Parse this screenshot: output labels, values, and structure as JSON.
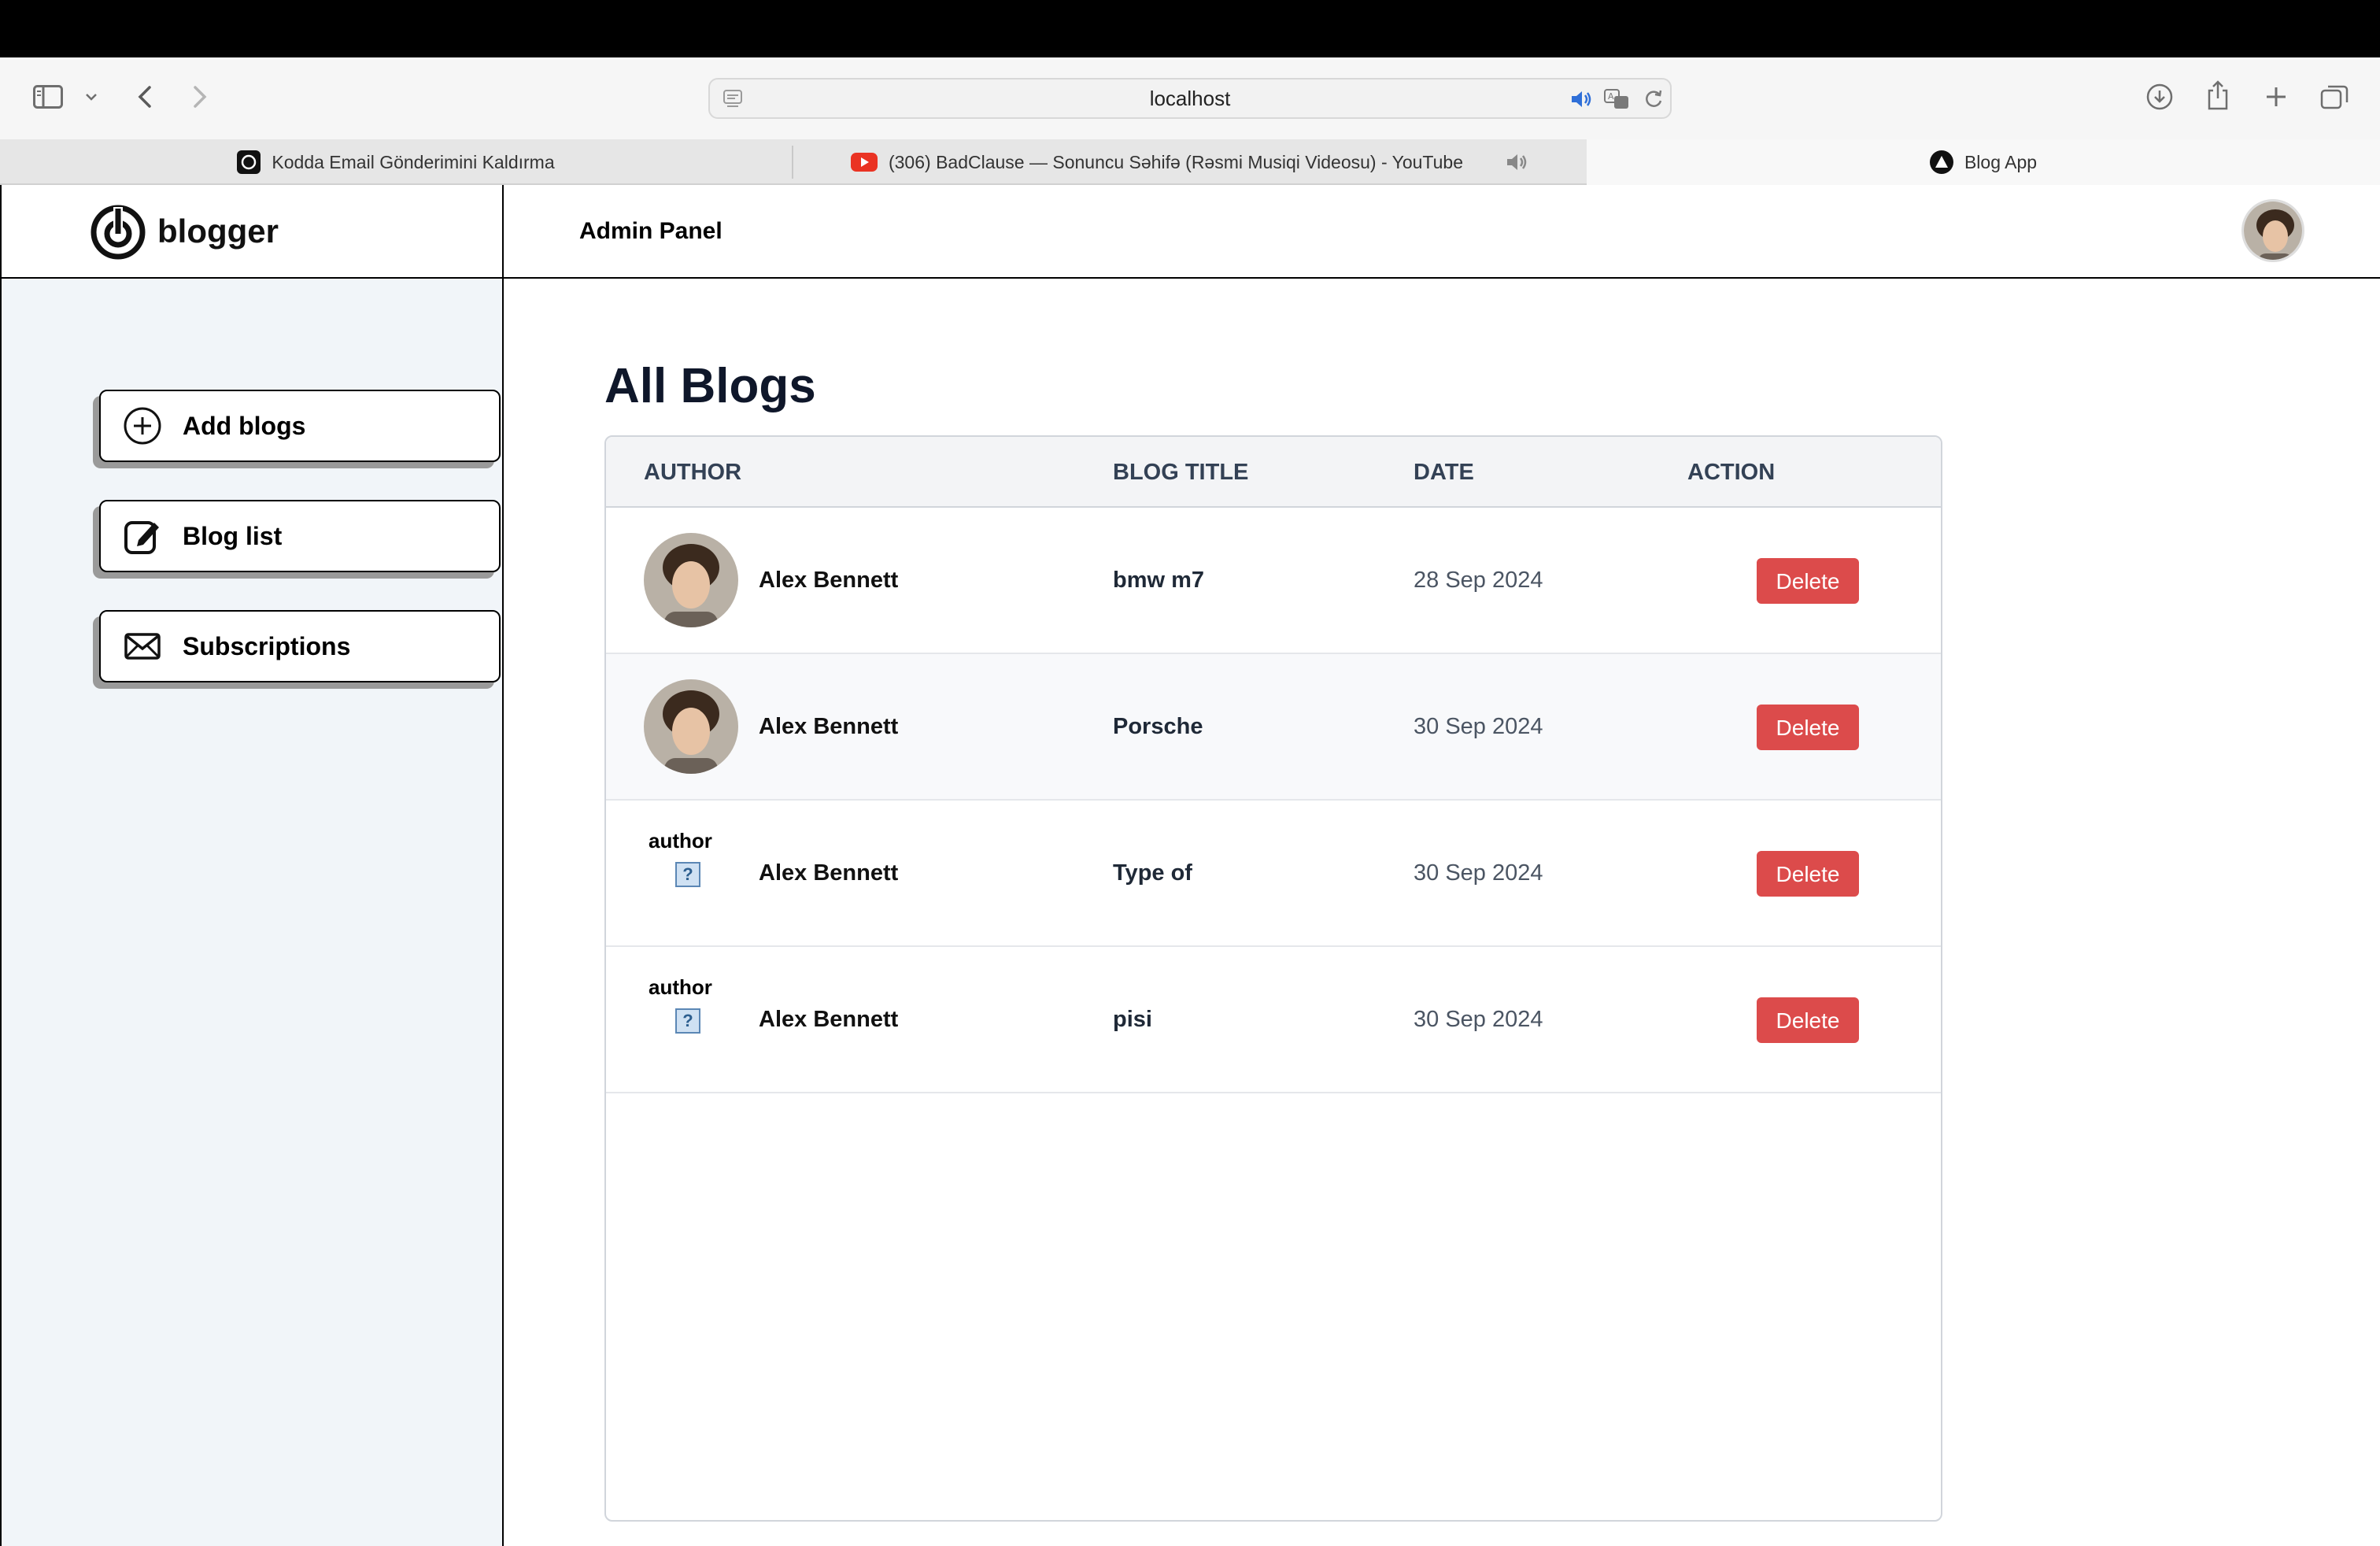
{
  "browser": {
    "url": "localhost",
    "tabs": [
      {
        "title": "Kodda Email Gönderimini Kaldırma",
        "icon": "openai-icon",
        "active": false
      },
      {
        "title": "(306) BadClause — Sonuncu Səhifə (Rəsmi Musiqi Videosu) - YouTube",
        "icon": "youtube-icon",
        "active": false,
        "audio": true
      },
      {
        "title": "Blog App",
        "icon": "blog-app-icon",
        "active": true
      }
    ],
    "close_tab_glyph": "×"
  },
  "app": {
    "brand": "blogger",
    "header_title": "Admin Panel"
  },
  "sidebar": {
    "items": [
      {
        "label": "Add blogs",
        "icon": "plus-circle-icon"
      },
      {
        "label": "Blog list",
        "icon": "edit-icon"
      },
      {
        "label": "Subscriptions",
        "icon": "mail-icon"
      }
    ]
  },
  "main": {
    "title": "All Blogs",
    "table": {
      "headers": [
        "AUTHOR",
        "BLOG TITLE",
        "DATE",
        "ACTION"
      ],
      "rows": [
        {
          "author": "Alex Bennett",
          "title": "bmw m7",
          "date": "28 Sep 2024",
          "action": "Delete",
          "image_alt": ""
        },
        {
          "author": "Alex Bennett",
          "title": "Porsche",
          "date": "30 Sep 2024",
          "action": "Delete",
          "image_alt": ""
        },
        {
          "author": "Alex Bennett",
          "title": "Type of",
          "date": "30 Sep 2024",
          "action": "Delete",
          "image_alt": "author"
        },
        {
          "author": "Alex Bennett",
          "title": "pisi",
          "date": "30 Sep 2024",
          "action": "Delete",
          "image_alt": "author"
        }
      ]
    }
  },
  "colors": {
    "delete": "#dc4b4b",
    "sidebar_bg": "#f1f5f9",
    "heading": "#0f172a"
  }
}
